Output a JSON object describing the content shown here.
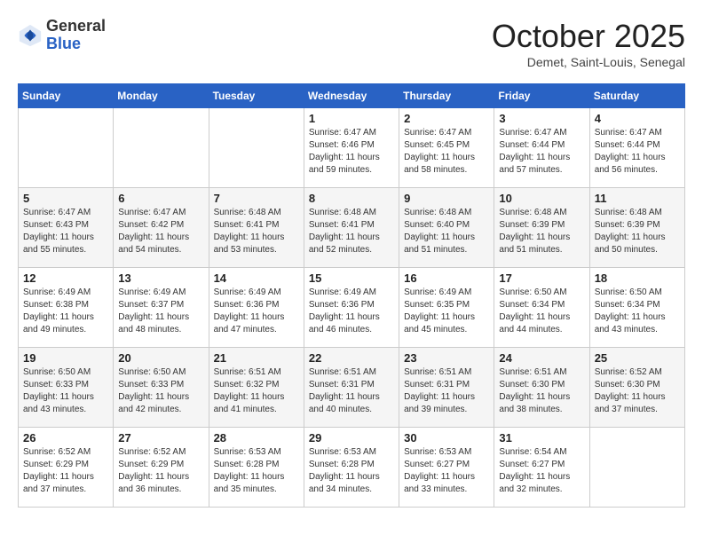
{
  "header": {
    "logo_general": "General",
    "logo_blue": "Blue",
    "month_title": "October 2025",
    "location": "Demet, Saint-Louis, Senegal"
  },
  "weekdays": [
    "Sunday",
    "Monday",
    "Tuesday",
    "Wednesday",
    "Thursday",
    "Friday",
    "Saturday"
  ],
  "weeks": [
    [
      {
        "day": "",
        "info": ""
      },
      {
        "day": "",
        "info": ""
      },
      {
        "day": "",
        "info": ""
      },
      {
        "day": "1",
        "info": "Sunrise: 6:47 AM\nSunset: 6:46 PM\nDaylight: 11 hours\nand 59 minutes."
      },
      {
        "day": "2",
        "info": "Sunrise: 6:47 AM\nSunset: 6:45 PM\nDaylight: 11 hours\nand 58 minutes."
      },
      {
        "day": "3",
        "info": "Sunrise: 6:47 AM\nSunset: 6:44 PM\nDaylight: 11 hours\nand 57 minutes."
      },
      {
        "day": "4",
        "info": "Sunrise: 6:47 AM\nSunset: 6:44 PM\nDaylight: 11 hours\nand 56 minutes."
      }
    ],
    [
      {
        "day": "5",
        "info": "Sunrise: 6:47 AM\nSunset: 6:43 PM\nDaylight: 11 hours\nand 55 minutes."
      },
      {
        "day": "6",
        "info": "Sunrise: 6:47 AM\nSunset: 6:42 PM\nDaylight: 11 hours\nand 54 minutes."
      },
      {
        "day": "7",
        "info": "Sunrise: 6:48 AM\nSunset: 6:41 PM\nDaylight: 11 hours\nand 53 minutes."
      },
      {
        "day": "8",
        "info": "Sunrise: 6:48 AM\nSunset: 6:41 PM\nDaylight: 11 hours\nand 52 minutes."
      },
      {
        "day": "9",
        "info": "Sunrise: 6:48 AM\nSunset: 6:40 PM\nDaylight: 11 hours\nand 51 minutes."
      },
      {
        "day": "10",
        "info": "Sunrise: 6:48 AM\nSunset: 6:39 PM\nDaylight: 11 hours\nand 51 minutes."
      },
      {
        "day": "11",
        "info": "Sunrise: 6:48 AM\nSunset: 6:39 PM\nDaylight: 11 hours\nand 50 minutes."
      }
    ],
    [
      {
        "day": "12",
        "info": "Sunrise: 6:49 AM\nSunset: 6:38 PM\nDaylight: 11 hours\nand 49 minutes."
      },
      {
        "day": "13",
        "info": "Sunrise: 6:49 AM\nSunset: 6:37 PM\nDaylight: 11 hours\nand 48 minutes."
      },
      {
        "day": "14",
        "info": "Sunrise: 6:49 AM\nSunset: 6:36 PM\nDaylight: 11 hours\nand 47 minutes."
      },
      {
        "day": "15",
        "info": "Sunrise: 6:49 AM\nSunset: 6:36 PM\nDaylight: 11 hours\nand 46 minutes."
      },
      {
        "day": "16",
        "info": "Sunrise: 6:49 AM\nSunset: 6:35 PM\nDaylight: 11 hours\nand 45 minutes."
      },
      {
        "day": "17",
        "info": "Sunrise: 6:50 AM\nSunset: 6:34 PM\nDaylight: 11 hours\nand 44 minutes."
      },
      {
        "day": "18",
        "info": "Sunrise: 6:50 AM\nSunset: 6:34 PM\nDaylight: 11 hours\nand 43 minutes."
      }
    ],
    [
      {
        "day": "19",
        "info": "Sunrise: 6:50 AM\nSunset: 6:33 PM\nDaylight: 11 hours\nand 43 minutes."
      },
      {
        "day": "20",
        "info": "Sunrise: 6:50 AM\nSunset: 6:33 PM\nDaylight: 11 hours\nand 42 minutes."
      },
      {
        "day": "21",
        "info": "Sunrise: 6:51 AM\nSunset: 6:32 PM\nDaylight: 11 hours\nand 41 minutes."
      },
      {
        "day": "22",
        "info": "Sunrise: 6:51 AM\nSunset: 6:31 PM\nDaylight: 11 hours\nand 40 minutes."
      },
      {
        "day": "23",
        "info": "Sunrise: 6:51 AM\nSunset: 6:31 PM\nDaylight: 11 hours\nand 39 minutes."
      },
      {
        "day": "24",
        "info": "Sunrise: 6:51 AM\nSunset: 6:30 PM\nDaylight: 11 hours\nand 38 minutes."
      },
      {
        "day": "25",
        "info": "Sunrise: 6:52 AM\nSunset: 6:30 PM\nDaylight: 11 hours\nand 37 minutes."
      }
    ],
    [
      {
        "day": "26",
        "info": "Sunrise: 6:52 AM\nSunset: 6:29 PM\nDaylight: 11 hours\nand 37 minutes."
      },
      {
        "day": "27",
        "info": "Sunrise: 6:52 AM\nSunset: 6:29 PM\nDaylight: 11 hours\nand 36 minutes."
      },
      {
        "day": "28",
        "info": "Sunrise: 6:53 AM\nSunset: 6:28 PM\nDaylight: 11 hours\nand 35 minutes."
      },
      {
        "day": "29",
        "info": "Sunrise: 6:53 AM\nSunset: 6:28 PM\nDaylight: 11 hours\nand 34 minutes."
      },
      {
        "day": "30",
        "info": "Sunrise: 6:53 AM\nSunset: 6:27 PM\nDaylight: 11 hours\nand 33 minutes."
      },
      {
        "day": "31",
        "info": "Sunrise: 6:54 AM\nSunset: 6:27 PM\nDaylight: 11 hours\nand 32 minutes."
      },
      {
        "day": "",
        "info": ""
      }
    ]
  ]
}
